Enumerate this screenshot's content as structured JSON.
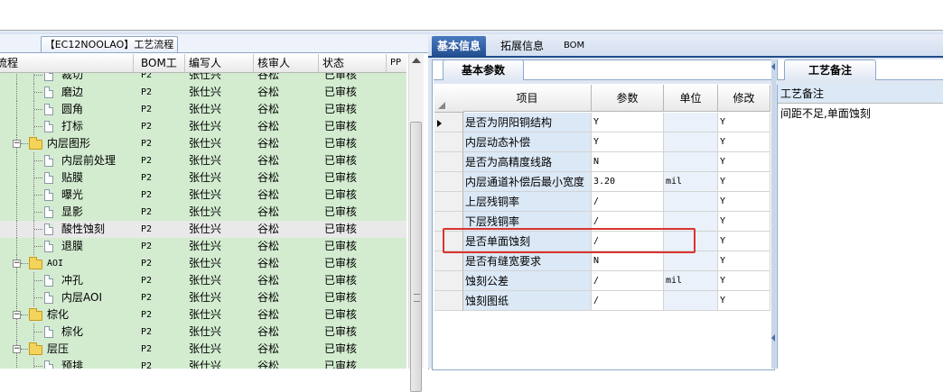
{
  "left": {
    "tab_title": "【EC12NOOLAO】工艺流程",
    "columns": [
      "流程",
      "BOM工厂",
      "编写人",
      "核审人",
      "状态",
      "PP"
    ],
    "rows": [
      {
        "name": "裁切",
        "level": 2,
        "kind": "doc",
        "bom": "P2",
        "writer": "张仕兴",
        "reviewer": "谷松",
        "status": "已审核"
      },
      {
        "name": "磨边",
        "level": 2,
        "kind": "doc",
        "bom": "P2",
        "writer": "张仕兴",
        "reviewer": "谷松",
        "status": "已审核"
      },
      {
        "name": "圆角",
        "level": 2,
        "kind": "doc",
        "bom": "P2",
        "writer": "张仕兴",
        "reviewer": "谷松",
        "status": "已审核"
      },
      {
        "name": "打标",
        "level": 2,
        "kind": "doc",
        "bom": "P2",
        "writer": "张仕兴",
        "reviewer": "谷松",
        "status": "已审核"
      },
      {
        "name": "内层图形",
        "level": 1,
        "kind": "folder",
        "bom": "P2",
        "writer": "张仕兴",
        "reviewer": "谷松",
        "status": "已审核"
      },
      {
        "name": "内层前处理",
        "level": 2,
        "kind": "doc",
        "bom": "P2",
        "writer": "张仕兴",
        "reviewer": "谷松",
        "status": "已审核"
      },
      {
        "name": "贴膜",
        "level": 2,
        "kind": "doc",
        "bom": "P2",
        "writer": "张仕兴",
        "reviewer": "谷松",
        "status": "已审核"
      },
      {
        "name": "曝光",
        "level": 2,
        "kind": "doc",
        "bom": "P2",
        "writer": "张仕兴",
        "reviewer": "谷松",
        "status": "已审核"
      },
      {
        "name": "显影",
        "level": 2,
        "kind": "doc",
        "bom": "P2",
        "writer": "张仕兴",
        "reviewer": "谷松",
        "status": "已审核"
      },
      {
        "name": "酸性蚀刻",
        "level": 2,
        "kind": "doc",
        "bom": "P2",
        "writer": "张仕兴",
        "reviewer": "谷松",
        "status": "已审核",
        "selected": true
      },
      {
        "name": "退膜",
        "level": 2,
        "kind": "doc",
        "bom": "P2",
        "writer": "张仕兴",
        "reviewer": "谷松",
        "status": "已审核"
      },
      {
        "name": "AOI",
        "level": 1,
        "kind": "folder",
        "bom": "P2",
        "writer": "张仕兴",
        "reviewer": "谷松",
        "status": "已审核"
      },
      {
        "name": "冲孔",
        "level": 2,
        "kind": "doc",
        "bom": "P2",
        "writer": "张仕兴",
        "reviewer": "谷松",
        "status": "已审核"
      },
      {
        "name": "内层AOI",
        "level": 2,
        "kind": "doc",
        "bom": "P2",
        "writer": "张仕兴",
        "reviewer": "谷松",
        "status": "已审核"
      },
      {
        "name": "棕化",
        "level": 1,
        "kind": "folder",
        "bom": "P2",
        "writer": "张仕兴",
        "reviewer": "谷松",
        "status": "已审核"
      },
      {
        "name": "棕化",
        "level": 2,
        "kind": "doc",
        "bom": "P2",
        "writer": "张仕兴",
        "reviewer": "谷松",
        "status": "已审核"
      },
      {
        "name": "层压",
        "level": 1,
        "kind": "folder",
        "bom": "P2",
        "writer": "张仕兴",
        "reviewer": "谷松",
        "status": "已审核"
      },
      {
        "name": "预排",
        "level": 2,
        "kind": "doc",
        "bom": "P2",
        "writer": "张仕兴",
        "reviewer": "谷松",
        "status": "已审核"
      }
    ]
  },
  "right": {
    "tabs": [
      "基本信息",
      "拓展信息",
      "BOM"
    ],
    "sub_tab": "基本参数",
    "columns": [
      "项目",
      "参数",
      "单位",
      "修改"
    ],
    "rows": [
      {
        "item": "是否为阴阳铜结构",
        "param": "Y",
        "unit": "",
        "mod": "Y",
        "current": true
      },
      {
        "item": "内层动态补偿",
        "param": "Y",
        "unit": "",
        "mod": "Y"
      },
      {
        "item": "是否为高精度线路",
        "param": "N",
        "unit": "",
        "mod": "Y"
      },
      {
        "item": "内层通道补偿后最小宽度",
        "param": "3.20",
        "unit": "mil",
        "mod": "Y"
      },
      {
        "item": "上层残铜率",
        "param": "/",
        "unit": "",
        "mod": "Y"
      },
      {
        "item": "下层残铜率",
        "param": "/",
        "unit": "",
        "mod": "Y"
      },
      {
        "item": "是否单面蚀刻",
        "param": "/",
        "unit": "",
        "mod": "Y"
      },
      {
        "item": "是否有缝宽要求",
        "param": "N",
        "unit": "",
        "mod": "Y"
      },
      {
        "item": "蚀刻公差",
        "param": "/",
        "unit": "mil",
        "mod": "Y"
      },
      {
        "item": "蚀刻图纸",
        "param": "/",
        "unit": "",
        "mod": "Y"
      }
    ]
  },
  "notes": {
    "tab": "工艺备注",
    "header": "工艺备注",
    "text": "间距不足,单面蚀刻"
  },
  "colors": {
    "tree_row": "#d3ecd0",
    "tab_active": "#244f92",
    "highlight": "#d9342e"
  }
}
